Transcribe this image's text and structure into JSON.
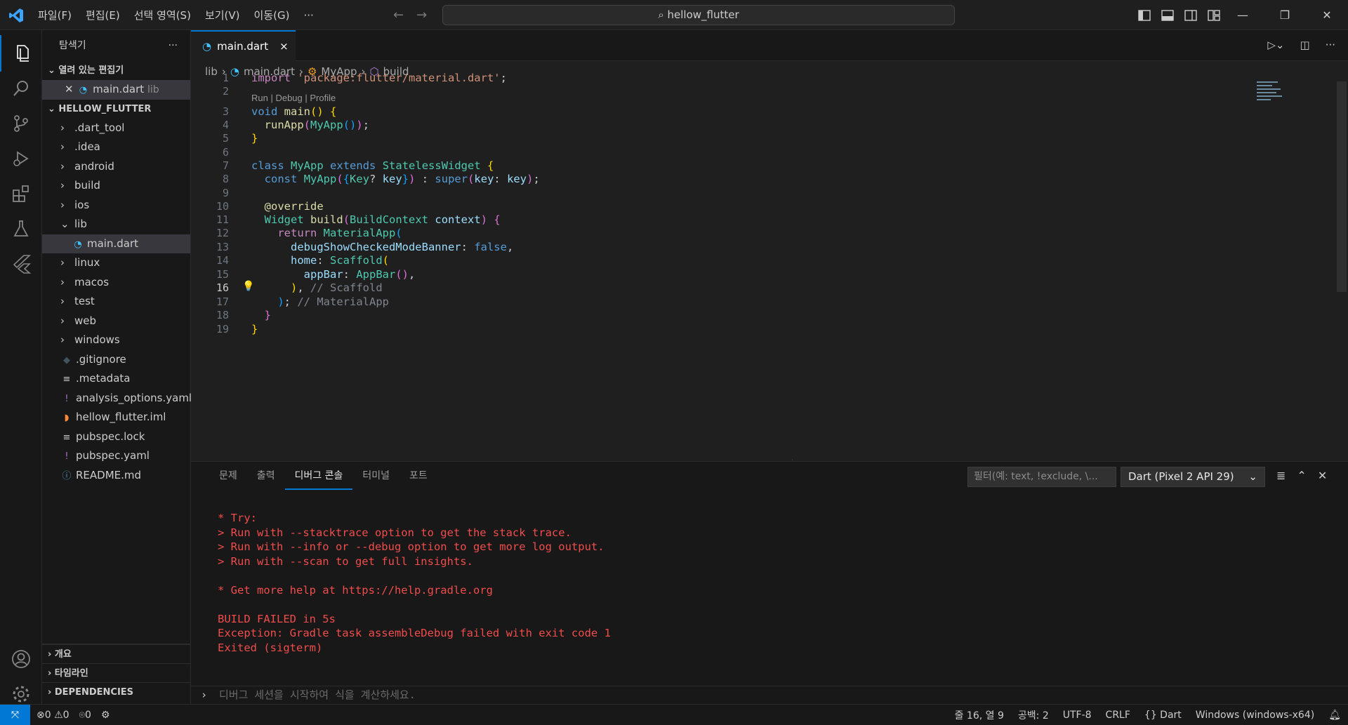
{
  "window": {
    "title": "hellow_flutter"
  },
  "menu": [
    "파일(F)",
    "편집(E)",
    "선택 영역(S)",
    "보기(V)",
    "이동(G)",
    "···"
  ],
  "sidebar": {
    "title": "탐색기",
    "open_editors": {
      "label": "열려 있는 편집기",
      "file": "main.dart",
      "folder": "lib"
    },
    "project": "HELLOW_FLUTTER",
    "items": [
      {
        "label": ".dart_tool",
        "kind": "folder"
      },
      {
        "label": ".idea",
        "kind": "folder"
      },
      {
        "label": "android",
        "kind": "folder"
      },
      {
        "label": "build",
        "kind": "folder"
      },
      {
        "label": "ios",
        "kind": "folder"
      },
      {
        "label": "lib",
        "kind": "folder-open"
      },
      {
        "label": "main.dart",
        "kind": "dart"
      },
      {
        "label": "linux",
        "kind": "folder"
      },
      {
        "label": "macos",
        "kind": "folder"
      },
      {
        "label": "test",
        "kind": "folder"
      },
      {
        "label": "web",
        "kind": "folder"
      },
      {
        "label": "windows",
        "kind": "folder"
      },
      {
        "label": ".gitignore",
        "kind": "git"
      },
      {
        "label": ".metadata",
        "kind": "lines"
      },
      {
        "label": "analysis_options.yaml",
        "kind": "yaml"
      },
      {
        "label": "hellow_flutter.iml",
        "kind": "rss"
      },
      {
        "label": "pubspec.lock",
        "kind": "lines"
      },
      {
        "label": "pubspec.yaml",
        "kind": "yaml"
      },
      {
        "label": "README.md",
        "kind": "info"
      }
    ],
    "bottom": [
      "개요",
      "타임라인",
      "DEPENDENCIES"
    ]
  },
  "tab": {
    "label": "main.dart",
    "close": "×"
  },
  "breadcrumbs": {
    "lib": "lib",
    "file": "main.dart",
    "class": "MyApp",
    "method": "build"
  },
  "codelens": "Run | Debug | Profile",
  "lines": [
    "1",
    "2",
    "3",
    "4",
    "5",
    "6",
    "7",
    "8",
    "9",
    "10",
    "11",
    "12",
    "13",
    "14",
    "15",
    "16",
    "17",
    "18",
    "19"
  ],
  "panel": {
    "tabs": [
      "문제",
      "출력",
      "디버그 콘솔",
      "터미널",
      "포트"
    ],
    "filter_placeholder": "필터(예: text, !exclude, \\...",
    "session": "Dart (Pixel 2 API 29)",
    "console": [
      "* Try:",
      "> Run with --stacktrace option to get the stack trace.",
      "> Run with --info or --debug option to get more log output.",
      "> Run with --scan to get full insights.",
      "",
      "* Get more help at https://help.gradle.org",
      "",
      "BUILD FAILED in 5s",
      "Exception: Gradle task assembleDebug failed with exit code 1",
      "Exited (sigterm)"
    ],
    "prompt_placeholder": "디버그 세션을 시작하여 식을 계산하세요."
  },
  "status": {
    "errors": "0",
    "warnings": "0",
    "ports": "0",
    "position": "줄 16, 열 9",
    "spaces": "공백: 2",
    "encoding": "UTF-8",
    "eol": "CRLF",
    "language": "Dart",
    "device": "Windows (windows-x64)"
  }
}
